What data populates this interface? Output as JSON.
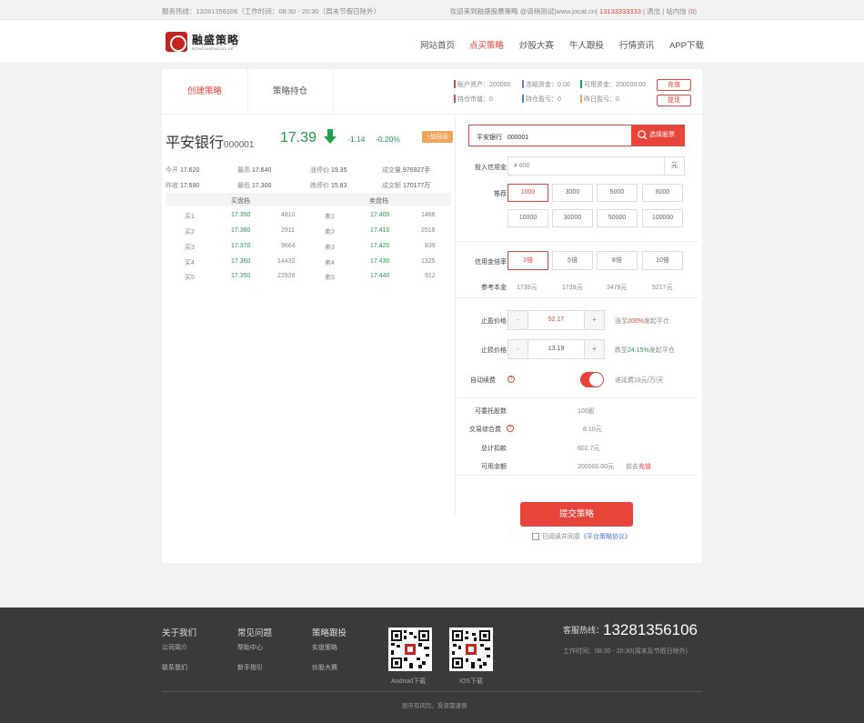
{
  "topbar": {
    "hotline": "服务热线：13281356106（工作时间：08:30 - 20:30（周末节假日除外）",
    "welcome": "欢迎来到融盛股票策略 @请稍测试|www.jocat.cn|",
    "phone": "13133333333",
    "sep1": "|",
    "logout": "退出",
    "sep2": "|",
    "message": "站内信",
    "msg_count": "0"
  },
  "header": {
    "logo_text": "融盛策略",
    "logo_sub": "RONGSHENGCELVE",
    "nav": [
      "网站首页",
      "点买策略",
      "炒股大赛",
      "牛人跟投",
      "行情资讯",
      "APP下载"
    ],
    "active_nav": 1
  },
  "tabs": {
    "create": "创建策略",
    "holdings": "策略持仓"
  },
  "account": {
    "total_assets": "账户资产：200000",
    "frozen": "冻结资金：0.00",
    "available": "可用资金：200000.00",
    "market_value": "持仓市值：0",
    "float_pl": "持仓盈亏：0",
    "yesterday_pl": "昨日盈亏：0",
    "recharge": "充值",
    "withdraw": "提现",
    "colors": {
      "total": "#e8443b",
      "frozen": "#8a6fd1",
      "available": "#22a14a",
      "market": "#e8443b",
      "float": "#4a8bd6",
      "yesterday": "#f0a35a"
    }
  },
  "stock": {
    "name": "平安银行",
    "code": "000001",
    "price": "17.39",
    "change": "-1.14",
    "change_pct": "-0.20%",
    "fav": "+加自选",
    "quote": [
      {
        "label": "今开",
        "value": "17.620"
      },
      {
        "label": "最高",
        "value": "17.640"
      },
      {
        "label": "涨停价",
        "value": "19.35"
      },
      {
        "label": "成交量",
        "value": "976927手"
      },
      {
        "label": "昨收",
        "value": "17.590"
      },
      {
        "label": "最低",
        "value": "17.300"
      },
      {
        "label": "跌停价",
        "value": "15.83"
      },
      {
        "label": "成交额",
        "value": "170177万"
      }
    ],
    "buy_header": "买盘档",
    "sell_header": "卖盘档",
    "orderbook": [
      {
        "b": "买1",
        "bp": "17.350",
        "bv": "4810",
        "s": "卖1",
        "sp": "17.400",
        "sv": "1468"
      },
      {
        "b": "买2",
        "bp": "17.380",
        "bv": "2911",
        "s": "卖2",
        "sp": "17.410",
        "sv": "2518"
      },
      {
        "b": "买3",
        "bp": "17.370",
        "bv": "9664",
        "s": "卖3",
        "sp": "17.420",
        "sv": "839"
      },
      {
        "b": "买4",
        "bp": "17.360",
        "bv": "14432",
        "s": "卖4",
        "sp": "17.430",
        "sv": "1325"
      },
      {
        "b": "买5",
        "bp": "17.350",
        "bv": "22926",
        "s": "卖5",
        "sp": "17.440",
        "sv": "912"
      }
    ]
  },
  "form": {
    "search_value": "平安银行   000001",
    "search_btn": "选择股票",
    "credit_label": "投入信用金",
    "credit_placeholder": "¥ 600",
    "credit_unit": "元",
    "recommend_label": "推荐",
    "recommend": [
      "1000",
      "3000",
      "5000",
      "8000",
      "10000",
      "30000",
      "50000",
      "100000"
    ],
    "leverage_label": "信用金倍率",
    "leverage": [
      "3倍",
      "5倍",
      "8倍",
      "10倍"
    ],
    "ref_label": "参考本金",
    "ref_values": [
      "1739元",
      "1739元",
      "3478元",
      "5217元"
    ],
    "tp_label": "止盈价格",
    "tp_value": "52.17",
    "tp_hint_pre": "涨至",
    "tp_hint_pct": "200%",
    "tp_hint_post": "发起平仓",
    "sl_label": "止损价格",
    "sl_value": "13.19",
    "sl_hint_pre": "跌至",
    "sl_hint_pct": "24.15%",
    "sl_hint_post": "发起平仓",
    "minus": "-",
    "plus": "+",
    "auto_label": "自动续费",
    "auto_hint": "递延费18元/万/天",
    "qmark": "?",
    "shares_label": "可委托股数",
    "shares_value": "100股",
    "fee_label": "交易综合费",
    "fee_value": "8.10元",
    "total_label": "总计扣款",
    "total_value": "602.7元",
    "balance_label": "可用余额",
    "balance_value": "200000.00元",
    "balance_pre": "前去",
    "balance_link": "充值",
    "submit": "提交策略",
    "agree_pre": "已阅读并同意",
    "agree_link": "《平台策略协议》"
  },
  "footer": {
    "cols": [
      {
        "title": "关于我们",
        "links": [
          "公司简介",
          "联系我们"
        ]
      },
      {
        "title": "常见问题",
        "links": [
          "帮助中心",
          "新手指引"
        ]
      },
      {
        "title": "策略跟投",
        "links": [
          "实盘策略",
          "炒股大赛"
        ]
      }
    ],
    "android": "Android下载",
    "ios": "IOS下载",
    "hotline_label": "客服热线：",
    "hotline": "13281356106",
    "hours": "工作时间：08:30 - 20:30(周末及节假日除外)",
    "copy": "股市有风险，投资需谨慎"
  }
}
